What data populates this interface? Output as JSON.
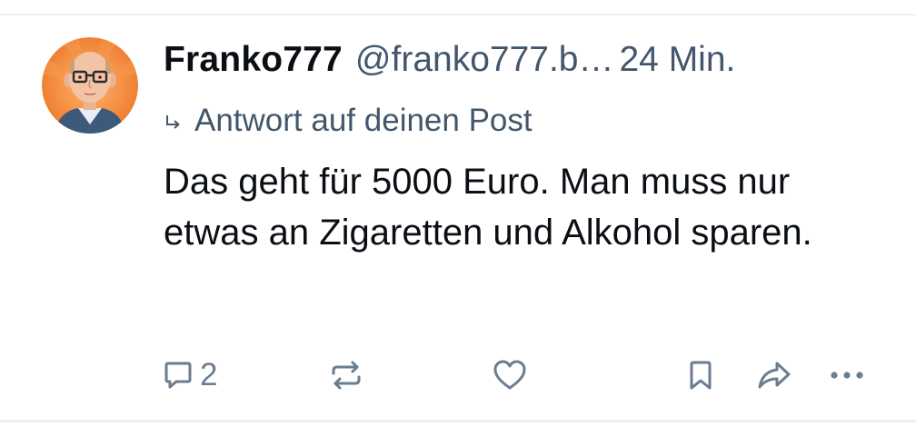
{
  "post": {
    "author": {
      "display_name": "Franko777",
      "handle": "@franko777.b…"
    },
    "time_ago": "24 Min.",
    "reply_context": "Antwort auf deinen Post",
    "text": "Das geht für 5000 Euro. Man muss nur etwas an Zigaretten und Alkohol sparen.",
    "stats": {
      "replies": "2"
    }
  },
  "icons": {
    "avatar": "avatar",
    "reply_indicator": "reply-arrow-icon",
    "comment": "comment-icon",
    "repost": "repost-icon",
    "like": "heart-icon",
    "bookmark": "bookmark-icon",
    "share": "share-icon",
    "more": "more-icon"
  },
  "colors": {
    "text_primary": "#0b0f14",
    "text_secondary": "#42576c",
    "icon": "#6b7d90",
    "avatar_background": "#f08a3c"
  }
}
